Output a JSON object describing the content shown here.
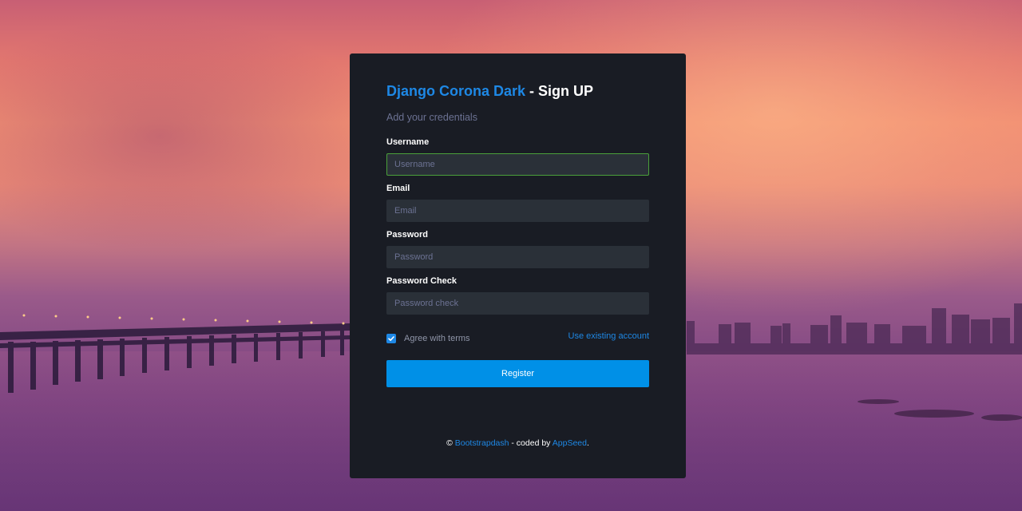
{
  "header": {
    "brand": "Django Corona Dark",
    "title_rest": " - Sign UP",
    "subtitle": "Add your credentials"
  },
  "form": {
    "username": {
      "label": "Username",
      "placeholder": "Username",
      "value": ""
    },
    "email": {
      "label": "Email",
      "placeholder": "Email",
      "value": ""
    },
    "password": {
      "label": "Password",
      "placeholder": "Password",
      "value": ""
    },
    "password_check": {
      "label": "Password Check",
      "placeholder": "Password check",
      "value": ""
    },
    "agree_terms": {
      "label": "Agree with terms",
      "checked": true
    },
    "existing_account_link": "Use existing account",
    "submit_label": "Register"
  },
  "footer": {
    "copyright": "©",
    "link1": "Bootstrapdash",
    "middle": " - coded by ",
    "link2": "AppSeed",
    "end": "."
  },
  "colors": {
    "card_bg": "#191c24",
    "accent": "#1e88e5",
    "button": "#0090e7",
    "input_bg": "#2a3038",
    "focus_border": "#4aa03a",
    "muted_text": "#6c7293"
  }
}
